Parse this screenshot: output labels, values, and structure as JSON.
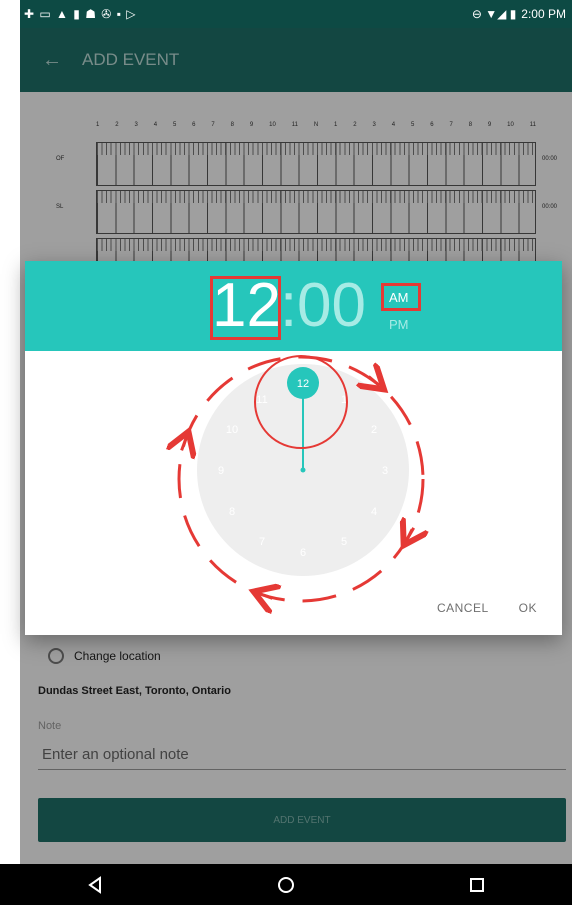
{
  "status_bar": {
    "left_icons": "✚ ▭ ▲ ▮ ☗ ✇ ▪ ▷",
    "right_icons": "⊖ ▼◢ ▮",
    "time": "2:00 PM"
  },
  "appbar": {
    "title": "ADD EVENT",
    "back_icon": "arrow-left-icon"
  },
  "log_grid": {
    "hour_labels": [
      "1",
      "2",
      "3",
      "4",
      "5",
      "6",
      "7",
      "8",
      "9",
      "10",
      "11",
      "N",
      "1",
      "2",
      "3",
      "4",
      "5",
      "6",
      "7",
      "8",
      "9",
      "10",
      "11"
    ],
    "rows": [
      {
        "label": "OF",
        "total": "00:00"
      },
      {
        "label": "SL",
        "total": "00:00"
      }
    ]
  },
  "location": {
    "change_label": "Change location",
    "address": "Dundas Street East, Toronto, Ontario"
  },
  "note": {
    "label": "Note",
    "placeholder": "Enter an optional note"
  },
  "add_event_button": "ADD EVENT",
  "time_dialog": {
    "hour": "12",
    "colon": ":",
    "minute": "00",
    "am": "AM",
    "pm": "PM",
    "selected_hour": "12",
    "dial_numbers": [
      "12",
      "1",
      "2",
      "3",
      "4",
      "5",
      "6",
      "7",
      "8",
      "9",
      "10",
      "11"
    ],
    "cancel": "CANCEL",
    "ok": "OK",
    "accent_color": "#26c6bb",
    "annotation_color": "#e53935"
  },
  "nav_bar": {
    "back_icon": "back-triangle-icon",
    "home_icon": "home-circle-icon",
    "recents_icon": "recents-square-icon"
  }
}
